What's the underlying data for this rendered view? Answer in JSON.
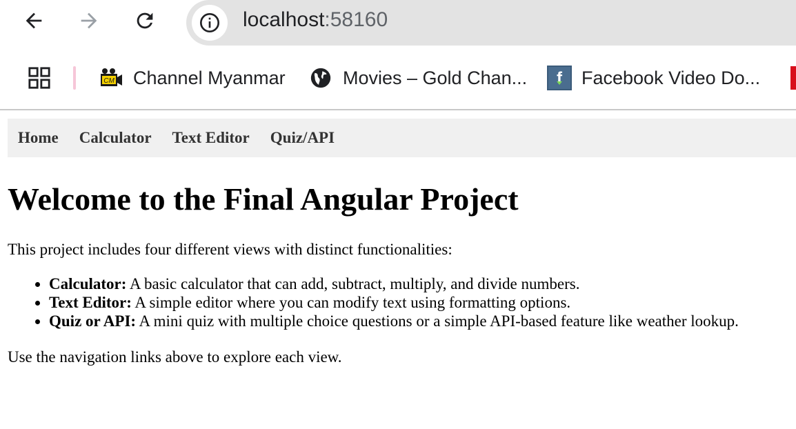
{
  "browser": {
    "url_host": "localhost",
    "url_port": ":58160",
    "bookmarks": [
      {
        "label": "Channel Myanmar",
        "icon": "channel-myanmar-favicon"
      },
      {
        "label": "Movies – Gold Chan...",
        "icon": "globe-icon"
      },
      {
        "label": "Facebook Video Do...",
        "icon": "facebook-favicon"
      }
    ]
  },
  "nav": {
    "links": [
      "Home",
      "Calculator",
      "Text Editor",
      "Quiz/API"
    ]
  },
  "main": {
    "title": "Welcome to the Final Angular Project",
    "intro": "This project includes four different views with distinct functionalities:",
    "features": [
      {
        "name": "Calculator:",
        "desc": " A basic calculator that can add, subtract, multiply, and divide numbers."
      },
      {
        "name": "Text Editor:",
        "desc": " A simple editor where you can modify text using formatting options."
      },
      {
        "name": "Quiz or API:",
        "desc": " A mini quiz with multiple choice questions or a simple API-based feature like weather lookup."
      }
    ],
    "outro": "Use the navigation links above to explore each view."
  },
  "colors": {
    "nav_bg": "#f0f0f0",
    "nav_text": "#333333",
    "omnibox_bg": "#e3e3e3"
  }
}
